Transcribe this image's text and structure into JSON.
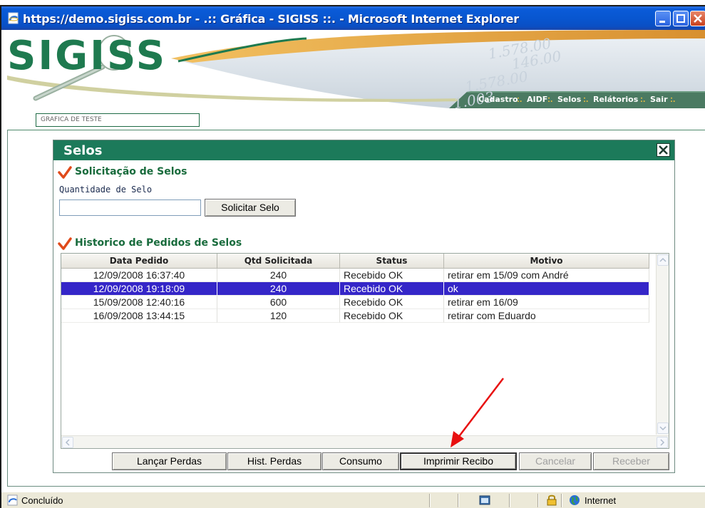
{
  "window": {
    "title": "https://demo.sigiss.com.br - .:: Gráfica - SIGISS ::. - Microsoft Internet Explorer"
  },
  "header": {
    "logo": "SIGISS",
    "background_numbers": [
      "1.578.00",
      "146.00",
      "1.578.00",
      "1.003."
    ],
    "company": "GRAFICA DE TESTE",
    "menu": [
      {
        "label": "Cadastro"
      },
      {
        "label": "AIDF"
      },
      {
        "label": "Selos"
      },
      {
        "label": "Relátorios"
      },
      {
        "label": "Sair"
      }
    ],
    "menu_separator": ":."
  },
  "dialog": {
    "title": "Selos",
    "request_section": {
      "title": "Solicitação de Selos",
      "quantity_label": "Quantidade de Selo",
      "quantity_value": "",
      "request_button": "Solicitar Selo"
    },
    "history_section": {
      "title": "Historico de Pedidos de Selos"
    },
    "table": {
      "columns": [
        "Data Pedido",
        "Qtd Solicitada",
        "Status",
        "Motivo"
      ],
      "rows": [
        {
          "date": "12/09/2008 16:37:40",
          "qty": "240",
          "status": "Recebido OK",
          "reason": "retirar em 15/09 com André",
          "selected": false
        },
        {
          "date": "12/09/2008 19:18:09",
          "qty": "240",
          "status": "Recebido OK",
          "reason": "ok",
          "selected": true
        },
        {
          "date": "15/09/2008 12:40:16",
          "qty": "600",
          "status": "Recebido OK",
          "reason": "retirar em 16/09",
          "selected": false
        },
        {
          "date": "16/09/2008 13:44:15",
          "qty": "120",
          "status": "Recebido OK",
          "reason": "retirar com Eduardo",
          "selected": false
        }
      ]
    },
    "buttons": {
      "lancar_perdas": "Lançar Perdas",
      "hist_perdas": "Hist. Perdas",
      "consumo": "Consumo",
      "imprimir_recibo": "Imprimir Recibo",
      "cancelar": "Cancelar",
      "receber": "Receber"
    }
  },
  "statusbar": {
    "status": "Concluído",
    "zone": "Internet"
  },
  "colors": {
    "titlebar": "#0856d0",
    "brand_green": "#1c7a5a",
    "section_green": "#186b3c",
    "selection": "#3526c8",
    "annotation_arrow": "#e81010"
  }
}
